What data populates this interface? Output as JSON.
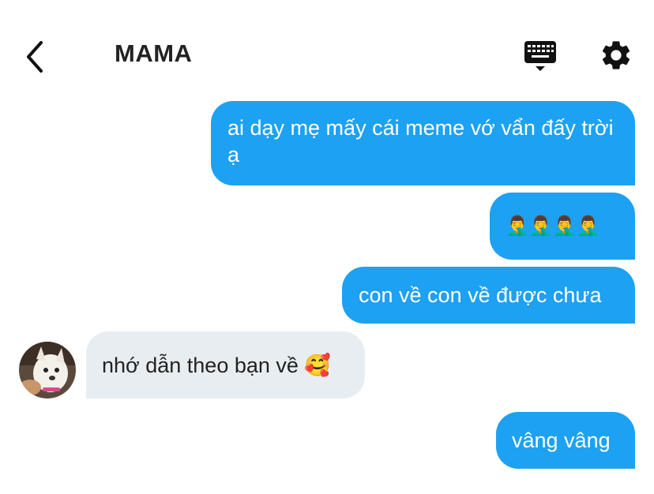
{
  "header": {
    "title": "MAMA",
    "icons": [
      "back-chevron-icon",
      "keyboard-icon",
      "gear-icon"
    ]
  },
  "messages": [
    {
      "direction": "outgoing",
      "text": "ai dạy mẹ mấy cái meme vớ vẩn đấy trời ạ"
    },
    {
      "direction": "outgoing",
      "text": "🤦‍♂️🤦‍♂️🤦‍♂️🤦‍♂️"
    },
    {
      "direction": "outgoing",
      "text": "con về con về được chưa"
    },
    {
      "direction": "incoming",
      "text": "nhớ dẫn theo bạn về 🥰"
    },
    {
      "direction": "outgoing",
      "text": "vâng vâng"
    }
  ],
  "colors": {
    "outgoing_bubble": "#1da1f2",
    "incoming_bubble": "#e8edf1",
    "title_text": "#222222"
  }
}
